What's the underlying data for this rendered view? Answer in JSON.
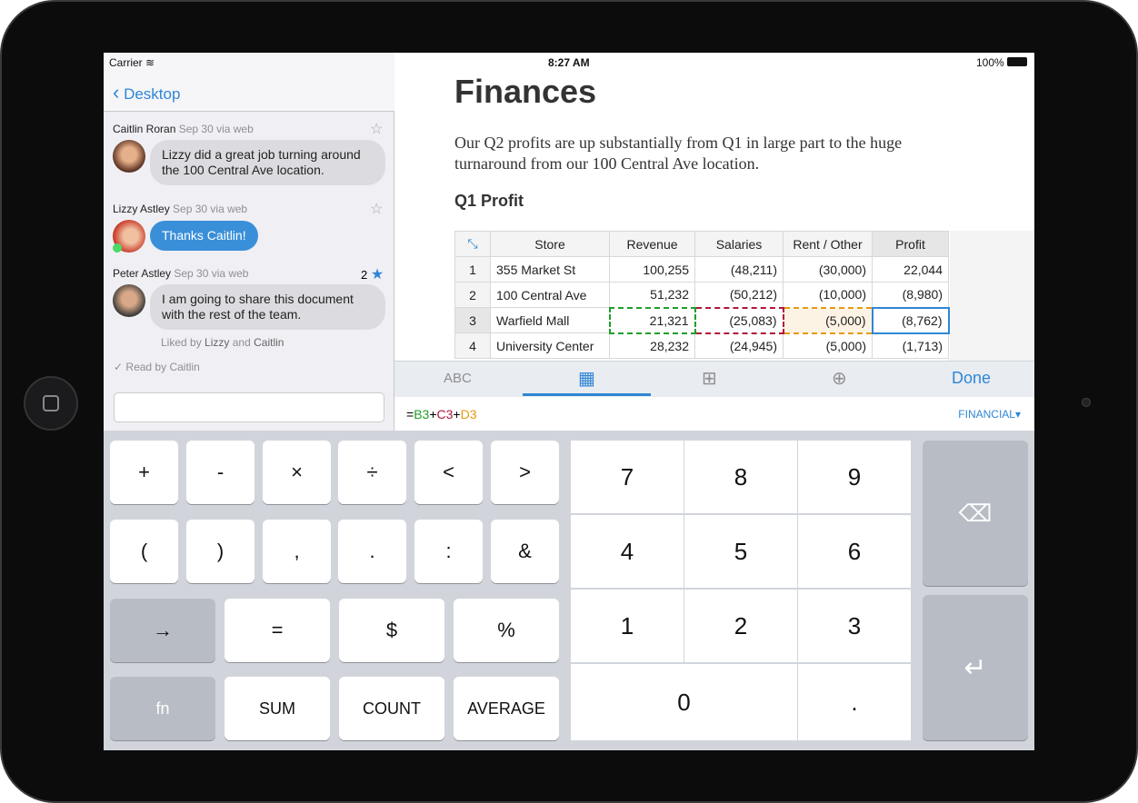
{
  "status": {
    "carrier": "Carrier",
    "time": "8:27 AM",
    "battery": "100%"
  },
  "chat": {
    "back_label": "Desktop",
    "messages": [
      {
        "author": "Caitlin Roran",
        "meta": "Sep 30 via web",
        "text": "Lizzy did a great job turning around the 100 Central Ave location.",
        "starred": false
      },
      {
        "author": "Lizzy Astley",
        "meta": "Sep 30 via web",
        "text": "Thanks Caitlin!",
        "starred": false
      },
      {
        "author": "Peter Astley",
        "meta": "Sep 30 via web",
        "text": "I am going to share this document with the rest of the team.",
        "starred": true,
        "star_count": "2"
      }
    ],
    "liked_prefix": "Liked by",
    "liked_a": "Lizzy",
    "liked_and": "and",
    "liked_b": "Caitlin",
    "read_prefix": "Read by",
    "read_name": "Caitlin"
  },
  "doc": {
    "title": "Finances",
    "body": "Our Q2 profits are up substantially from Q1 in large part to the huge turnaround from our 100 Central Ave location.",
    "section": "Q1 Profit",
    "columns": [
      "Store",
      "Revenue",
      "Salaries",
      "Rent / Other",
      "Profit"
    ],
    "rows": [
      [
        "1",
        "355 Market St",
        "100,255",
        "(48,211)",
        "(30,000)",
        "22,044"
      ],
      [
        "2",
        "100 Central Ave",
        "51,232",
        "(50,212)",
        "(10,000)",
        "(8,980)"
      ],
      [
        "3",
        "Warfield Mall",
        "21,321",
        "(25,083)",
        "(5,000)",
        "(8,762)"
      ],
      [
        "4",
        "University Center",
        "28,232",
        "(24,945)",
        "(5,000)",
        "(1,713)"
      ]
    ]
  },
  "toolbar": {
    "abc": "ABC",
    "done": "Done"
  },
  "formula": {
    "eq": "=",
    "b": "B3",
    "p1": "+",
    "c": "C3",
    "p2": "+",
    "d": "D3",
    "category": "FINANCIAL"
  },
  "colors": {
    "accent": "#2f86d6",
    "ref_b": "#1e9e2a",
    "ref_c": "#b0163a",
    "ref_d": "#e59a13"
  },
  "keys": {
    "ops1": [
      "+",
      "-",
      "×",
      "÷",
      "<",
      ">"
    ],
    "ops2": [
      "(",
      ")",
      ",",
      ".",
      ":",
      "&"
    ],
    "row3": [
      "→",
      "=",
      "$",
      "%"
    ],
    "row4": [
      "fn",
      "SUM",
      "COUNT",
      "AVERAGE"
    ],
    "digits": [
      "7",
      "8",
      "9",
      "4",
      "5",
      "6",
      "1",
      "2",
      "3"
    ],
    "zero": "0",
    "dot": "."
  }
}
